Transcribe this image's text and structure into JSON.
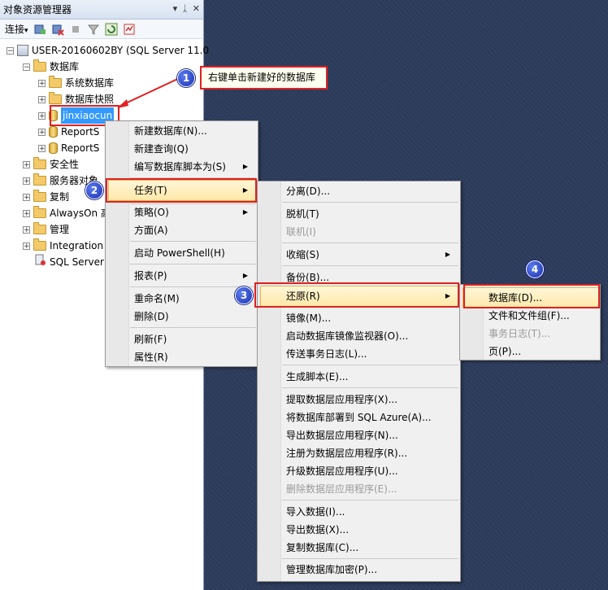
{
  "panel": {
    "title": "对象资源管理器",
    "title_icons": [
      "▾",
      "ᛣ",
      "✕"
    ],
    "connect_label": "连接",
    "connect_caret": "▾"
  },
  "tree": {
    "server": "USER-20160602BY (SQL Server 11.0",
    "databases": "数据库",
    "system_db": "系统数据库",
    "db_snapshots": "数据库快照",
    "selected_db": "jinxiaocun",
    "report1": "ReportS",
    "report2": "ReportS",
    "security": "安全性",
    "server_objects": "服务器对象",
    "replication": "复制",
    "alwayson": "AlwaysOn 高",
    "management": "管理",
    "integration": "Integration",
    "sql_agent": "SQL Server"
  },
  "callout": {
    "text": "右键单击新建好的数据库"
  },
  "steps": [
    "1",
    "2",
    "3",
    "4"
  ],
  "menu1": {
    "items": [
      "新建数据库(N)...",
      "新建查询(Q)",
      "编写数据库脚本为(S)",
      "任务(T)",
      "策略(O)",
      "方面(A)",
      "启动 PowerShell(H)",
      "报表(P)",
      "重命名(M)",
      "删除(D)",
      "刷新(F)",
      "属性(R)"
    ]
  },
  "menu2": {
    "items": [
      "分离(D)...",
      "脱机(T)",
      "联机(I)",
      "收缩(S)",
      "备份(B)...",
      "还原(R)",
      "镜像(M)...",
      "启动数据库镜像监视器(O)...",
      "传送事务日志(L)...",
      "生成脚本(E)...",
      "提取数据层应用程序(X)...",
      "将数据库部署到 SQL Azure(A)...",
      "导出数据层应用程序(N)...",
      "注册为数据层应用程序(R)...",
      "升级数据层应用程序(U)...",
      "删除数据层应用程序(E)...",
      "导入数据(I)...",
      "导出数据(X)...",
      "复制数据库(C)...",
      "管理数据库加密(P)..."
    ]
  },
  "menu3": {
    "items": [
      "数据库(D)...",
      "文件和文件组(F)...",
      "事务日志(T)...",
      "页(P)..."
    ]
  },
  "submenu_arrow": "▶",
  "colors": {
    "highlight_border": "#e02020",
    "selection": "#3399ff",
    "background": "#2d3c5c"
  }
}
